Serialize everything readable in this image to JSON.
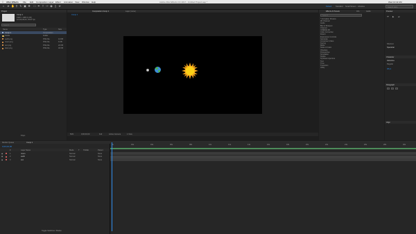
{
  "menubar": {
    "apple_icon": "apple-icon",
    "app_name": "After Effects",
    "items": [
      "File",
      "Edit",
      "Composition",
      "Layer",
      "Effect",
      "Animation",
      "View",
      "Window",
      "Help"
    ],
    "title": "Adobe After Effects CC 2017 - Untitled Project.aep *",
    "right_items": [
      "Wed 10:42 AM"
    ]
  },
  "toolbar": {
    "tools": [
      "home-icon",
      "arrow-icon",
      "hand-icon",
      "zoom-icon",
      "rotate-icon",
      "camera-icon",
      "pan-icon",
      "rect-icon",
      "pen-icon",
      "text-icon",
      "brush-icon",
      "clone-icon",
      "eraser-icon",
      "puppet-icon"
    ],
    "workspace_tabs": [
      "Default",
      "Standard",
      "Small Screen",
      "Libraries"
    ],
    "search_placeholder": "Search Help"
  },
  "project_panel": {
    "tab": "Project",
    "thumb_info": [
      "Comp 1",
      "1920 x 1080 (1.00)",
      "Δ 0;00;30;00, 29.97 fps"
    ],
    "search_placeholder": "Search",
    "columns": [
      "Name",
      "Type",
      "Size"
    ],
    "items": [
      {
        "name": "Comp 1",
        "type": "Composition",
        "size": ""
      },
      {
        "name": "Solids",
        "type": "Folder",
        "size": ""
      },
      {
        "name": "earth.png",
        "type": "PNG file",
        "size": "14 KB"
      },
      {
        "name": "moon.png",
        "type": "PNG file",
        "size": "6 KB"
      },
      {
        "name": "sun.png",
        "type": "PNG file",
        "size": "22 KB"
      },
      {
        "name": "stars.png",
        "type": "PNG file",
        "size": "40 KB"
      }
    ],
    "bpc": "8 bpc"
  },
  "comp_panel": {
    "tab": "Composition Comp 1",
    "tab2": "Layer (none)",
    "breadcrumb": "Comp 1",
    "footer": [
      "50%",
      "0;00;00;00",
      "Full",
      "Active Camera",
      "1 View"
    ]
  },
  "effects_panel": {
    "tabs": [
      "Effects & Presets",
      "Info",
      "Audio"
    ],
    "search_placeholder": "Search",
    "items": [
      "* Animation Presets",
      "3D Channel",
      "Audio",
      "Blur & Sharpen",
      "Channel",
      "CINEMA 4D",
      "Color Correction",
      "Distort",
      "Expression Controls",
      "Generate",
      "Immersive Video",
      "Keying",
      "Matte",
      "Noise & Grain",
      "Obsolete",
      "Perspective",
      "Simulation",
      "Stylize",
      "Synthetic Aperture",
      "Text",
      "Time",
      "Transition",
      "Utility"
    ]
  },
  "right_panel": {
    "sections": [
      "Preview",
      "Character",
      "Paragraph",
      "Align"
    ],
    "shortcut_label": "Shortcut",
    "shortcut_value": "Spacebar",
    "font_name": "Helvetica",
    "font_style": "Regular",
    "font_size": "48 px"
  },
  "timeline": {
    "tabs": [
      "Render Queue",
      "Comp 1"
    ],
    "timecode": "0;00;00;00",
    "columns": [
      "#",
      "Layer Name",
      "Mode",
      "T",
      "TrkMat",
      "Parent"
    ],
    "layers": [
      {
        "num": "1",
        "name": "moon",
        "mode": "Normal",
        "parent": "None"
      },
      {
        "num": "2",
        "name": "earth",
        "mode": "Normal",
        "parent": "None"
      },
      {
        "num": "3",
        "name": "sun",
        "mode": "Normal",
        "parent": "None"
      }
    ],
    "ruler": [
      "0s",
      "02s",
      "04s",
      "06s",
      "08s",
      "10s",
      "12s",
      "14s",
      "16s",
      "18s",
      "20s",
      "22s",
      "24s",
      "26s",
      "28s",
      "30s"
    ],
    "bottom_label": "Toggle Switches / Modes"
  },
  "colors": {
    "accent": "#2d8ceb",
    "sun": "#f6a51b",
    "sun_core": "#fcd116",
    "earth_blue": "#3c8ed6",
    "earth_green": "#4db24d",
    "moon": "#e6e6e6",
    "layer_green": "#4d8c5a"
  }
}
